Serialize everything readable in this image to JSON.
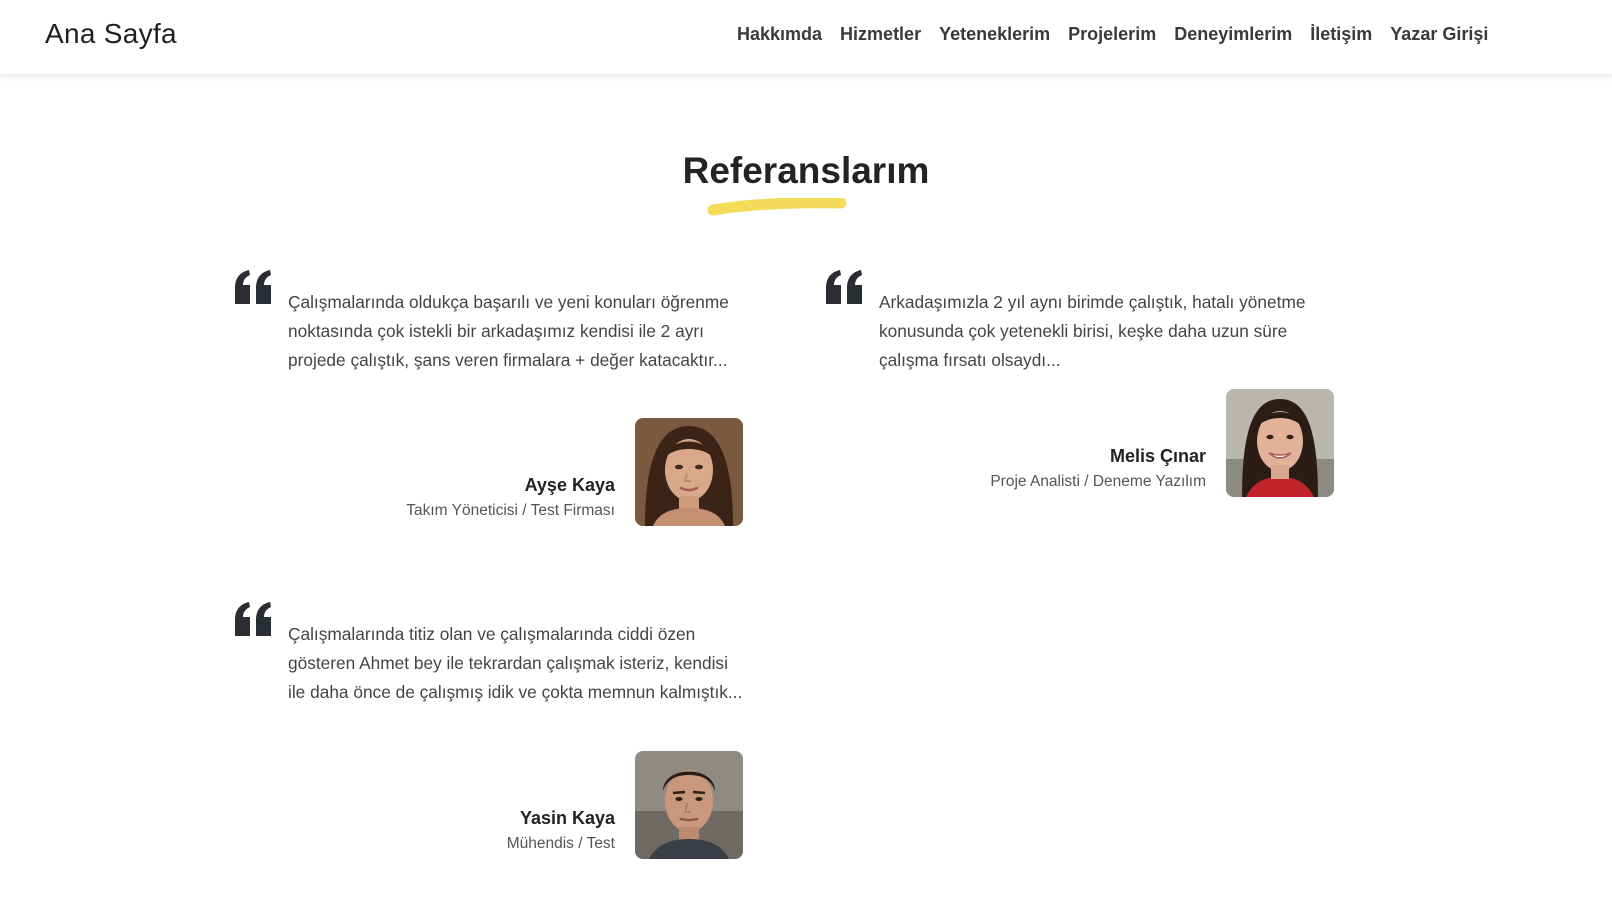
{
  "navbar": {
    "brand": "Ana Sayfa",
    "links": [
      "Hakkımda",
      "Hizmetler",
      "Yeteneklerim",
      "Projelerim",
      "Deneyimlerim",
      "İletişim",
      "Yazar Girişi"
    ]
  },
  "section": {
    "title": "Referanslarım",
    "accent_color": "#f4dc5a"
  },
  "testimonials": [
    {
      "text": "Çalışmalarında oldukça başarılı ve yeni konuları öğrenme noktasında çok istekli bir arkadaşımız kendisi ile 2 ayrı projede çalıştık, şans veren firmalara + değer katacaktır...",
      "name": "Ayşe Kaya",
      "role": "Takım Yöneticisi / Test Firması",
      "avatar": "woman-portrait-avatar"
    },
    {
      "text": "Arkadaşımızla 2 yıl aynı birimde çalıştık, hatalı yönetme konusunda çok yetenekli birisi, keşke daha uzun süre çalışma fırsatı olsaydı...",
      "name": "Melis Çınar",
      "role": "Proje Analisti / Deneme Yazılım",
      "avatar": "smiling-woman-portrait-avatar"
    },
    {
      "text": "Çalışmalarında titiz olan ve çalışmalarında ciddi özen gösteren Ahmet bey ile tekrardan çalışmak isteriz, kendisi ile daha önce de çalışmış idik ve çokta memnun kalmıştık...",
      "name": "Yasin Kaya",
      "role": "Mühendis / Test",
      "avatar": "man-portrait-avatar"
    }
  ],
  "colors": {
    "text_dark": "#232323",
    "text_body": "#444444",
    "quote_icon": "#2a2d33"
  }
}
